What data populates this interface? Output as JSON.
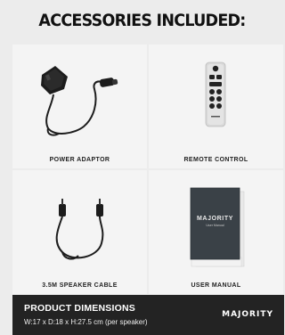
{
  "heading": "ACCESSORIES INCLUDED:",
  "items": [
    {
      "label": "POWER ADAPTOR",
      "icon": "power-adaptor-icon"
    },
    {
      "label": "REMOTE CONTROL",
      "icon": "remote-control-icon"
    },
    {
      "label": "3.5M SPEAKER CABLE",
      "icon": "speaker-cable-icon"
    },
    {
      "label": "USER MANUAL",
      "icon": "user-manual-icon"
    }
  ],
  "manual": {
    "brand": "MAJORITY",
    "subtitle": "User Manual"
  },
  "footer": {
    "title": "PRODUCT DIMENSIONS",
    "dimensions": "W:17 x D:18 x H:27.5 cm (per speaker)",
    "brand": "MAJORITY"
  }
}
